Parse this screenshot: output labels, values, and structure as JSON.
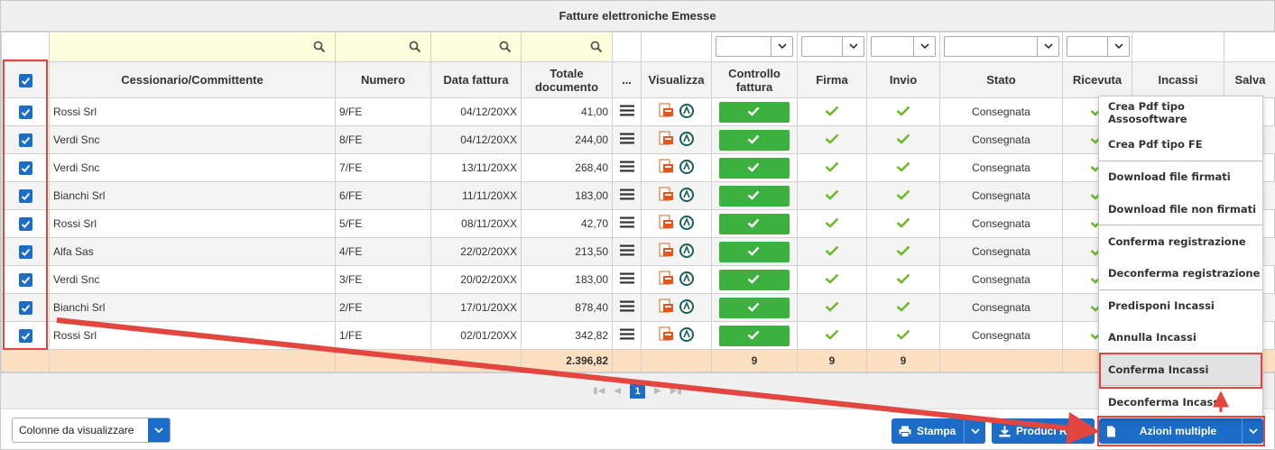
{
  "title": "Fatture elettroniche Emesse",
  "columns": [
    "Cessionario/Committente",
    "Numero",
    "Data fattura",
    "Totale documento",
    "...",
    "Visualizza",
    "Controllo fattura",
    "Firma",
    "Invio",
    "Stato",
    "Ricevuta",
    "Incassi",
    "Salva"
  ],
  "rows": [
    {
      "cliente": "Rossi Srl",
      "numero": "9/FE",
      "data": "04/12/20XX",
      "totale": "41,00",
      "stato": "Consegnata"
    },
    {
      "cliente": "Verdi Snc",
      "numero": "8/FE",
      "data": "04/12/20XX",
      "totale": "244,00",
      "stato": "Consegnata"
    },
    {
      "cliente": "Verdi Snc",
      "numero": "7/FE",
      "data": "13/11/20XX",
      "totale": "268,40",
      "stato": "Consegnata"
    },
    {
      "cliente": "Bianchi Srl",
      "numero": "6/FE",
      "data": "11/11/20XX",
      "totale": "183,00",
      "stato": "Consegnata"
    },
    {
      "cliente": "Rossi Srl",
      "numero": "5/FE",
      "data": "08/11/20XX",
      "totale": "42,70",
      "stato": "Consegnata"
    },
    {
      "cliente": "Alfa Sas",
      "numero": "4/FE",
      "data": "22/02/20XX",
      "totale": "213,50",
      "stato": "Consegnata"
    },
    {
      "cliente": "Verdi Snc",
      "numero": "3/FE",
      "data": "20/02/20XX",
      "totale": "183,00",
      "stato": "Consegnata"
    },
    {
      "cliente": "Bianchi Srl",
      "numero": "2/FE",
      "data": "17/01/20XX",
      "totale": "878,40",
      "stato": "Consegnata"
    },
    {
      "cliente": "Rossi Srl",
      "numero": "1/FE",
      "data": "02/01/20XX",
      "totale": "342,82",
      "stato": "Consegnata"
    }
  ],
  "totals": {
    "totale": "2.396,82",
    "controllo": "9",
    "firma": "9",
    "invio": "9",
    "ricevuta": "9"
  },
  "pager": {
    "current": "1"
  },
  "footer": {
    "colonne_label": "Colonne da visualizzare",
    "stampa_label": "Stampa",
    "riba_label": "Produci RiBa",
    "azioni_label": "Azioni multiple"
  },
  "menu": [
    "Crea Pdf tipo Assosoftware",
    "Crea Pdf tipo FE",
    "Download file firmati",
    "Download file non firmati",
    "Conferma registrazione",
    "Deconferma registrazione",
    "Predisponi Incassi",
    "Annulla Incassi",
    "Conferma Incassi",
    "Deconferma Incassi"
  ],
  "colors": {
    "accent": "#1b6dc7",
    "success": "#3db13f",
    "highlight": "#e2463f",
    "totals_bg": "#fde0c2",
    "filter_bg": "#ffffdd"
  }
}
